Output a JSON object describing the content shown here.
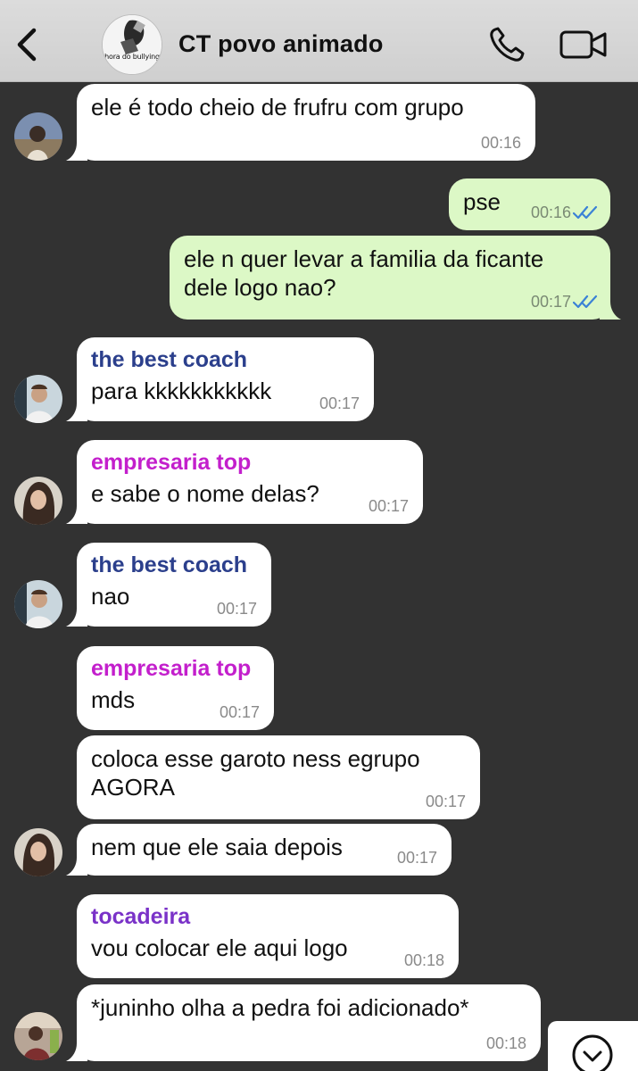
{
  "header": {
    "title": "CT povo animado",
    "avatar_caption": "hora do bullying",
    "back_icon": "chevron-left-icon",
    "call_icon": "phone-icon",
    "video_icon": "video-camera-icon"
  },
  "messages": [
    {
      "text": "ele é todo cheio de frufru com grupo",
      "time": "00:16"
    },
    {
      "text": "pse",
      "time": "00:16"
    },
    {
      "line1": "ele n quer levar a familia da ficante",
      "line2": "dele logo nao?",
      "time": "00:17"
    },
    {
      "sender": "the best coach",
      "text": "para kkkkkkkkkkk",
      "time": "00:17"
    },
    {
      "sender": "empresaria top",
      "text": "e sabe o nome delas?",
      "time": "00:17"
    },
    {
      "sender": "the best coach",
      "text": "nao",
      "time": "00:17"
    },
    {
      "sender": "empresaria top",
      "text": "mds",
      "time": "00:17"
    },
    {
      "line1": "coloca esse garoto ness egrupo",
      "line2": "AGORA",
      "time": "00:17"
    },
    {
      "text": "nem que ele saia depois",
      "time": "00:17"
    },
    {
      "sender": "tocadeira",
      "text": "vou colocar ele aqui logo",
      "time": "00:18"
    },
    {
      "text": "*juninho olha a pedra foi adicionado*",
      "time": "00:18"
    }
  ],
  "colors": {
    "background": "#323232",
    "incoming_bubble": "#ffffff",
    "outgoing_bubble": "#dcf8c6",
    "read_ticks": "#3b82d6",
    "coach_name": "#2b3f8c",
    "empresaria_name": "#c31fcc",
    "tocadeira_name": "#7a32c8"
  },
  "scroll_button_icon": "chevron-down-circle-icon"
}
